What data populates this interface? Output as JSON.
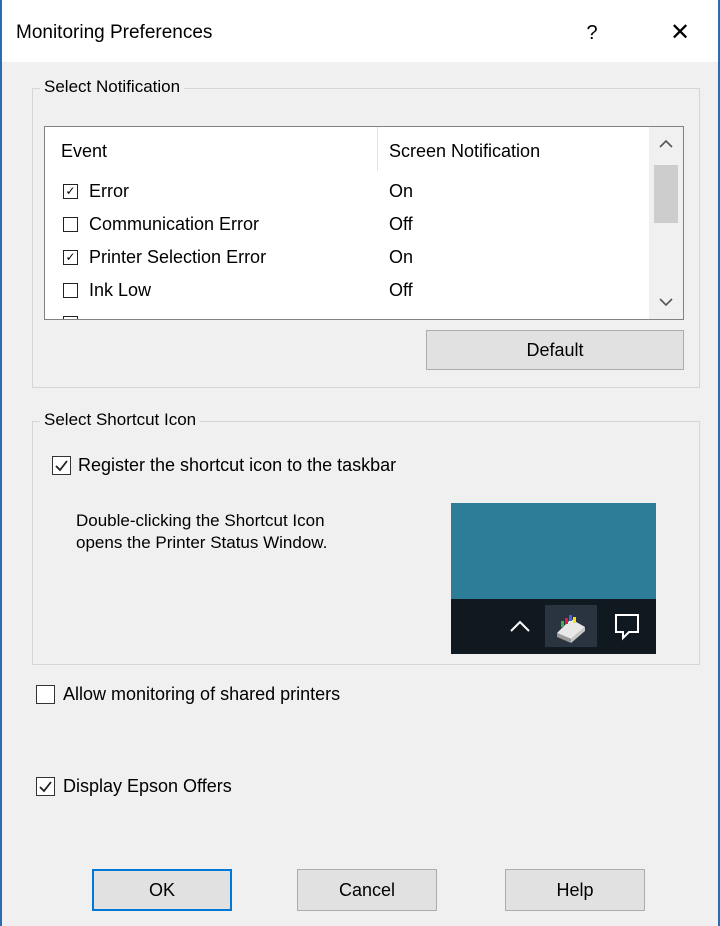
{
  "window": {
    "title": "Monitoring Preferences",
    "help_glyph": "?",
    "close_glyph": "✕"
  },
  "notification_group": {
    "label": "Select Notification",
    "columns": [
      "Event",
      "Screen Notification"
    ],
    "rows": [
      {
        "event": "Error",
        "checked": true,
        "notification": "On"
      },
      {
        "event": "Communication Error",
        "checked": false,
        "notification": "Off"
      },
      {
        "event": "Printer Selection Error",
        "checked": true,
        "notification": "On"
      },
      {
        "event": "Ink Low",
        "checked": false,
        "notification": "Off"
      }
    ],
    "default_button": "Default"
  },
  "shortcut_group": {
    "label": "Select Shortcut Icon",
    "register_label": "Register the shortcut icon to the taskbar",
    "register_checked": true,
    "description_line1": "Double-clicking the Shortcut Icon",
    "description_line2": "opens the Printer Status Window."
  },
  "options": {
    "shared_label": "Allow monitoring of shared printers",
    "shared_checked": false,
    "offers_label": "Display Epson Offers",
    "offers_checked": true
  },
  "buttons": {
    "ok": "OK",
    "cancel": "Cancel",
    "help": "Help"
  },
  "colors": {
    "accent": "#0078d7",
    "preview_bg": "#2d7d99",
    "taskbar_bg": "#101820"
  }
}
